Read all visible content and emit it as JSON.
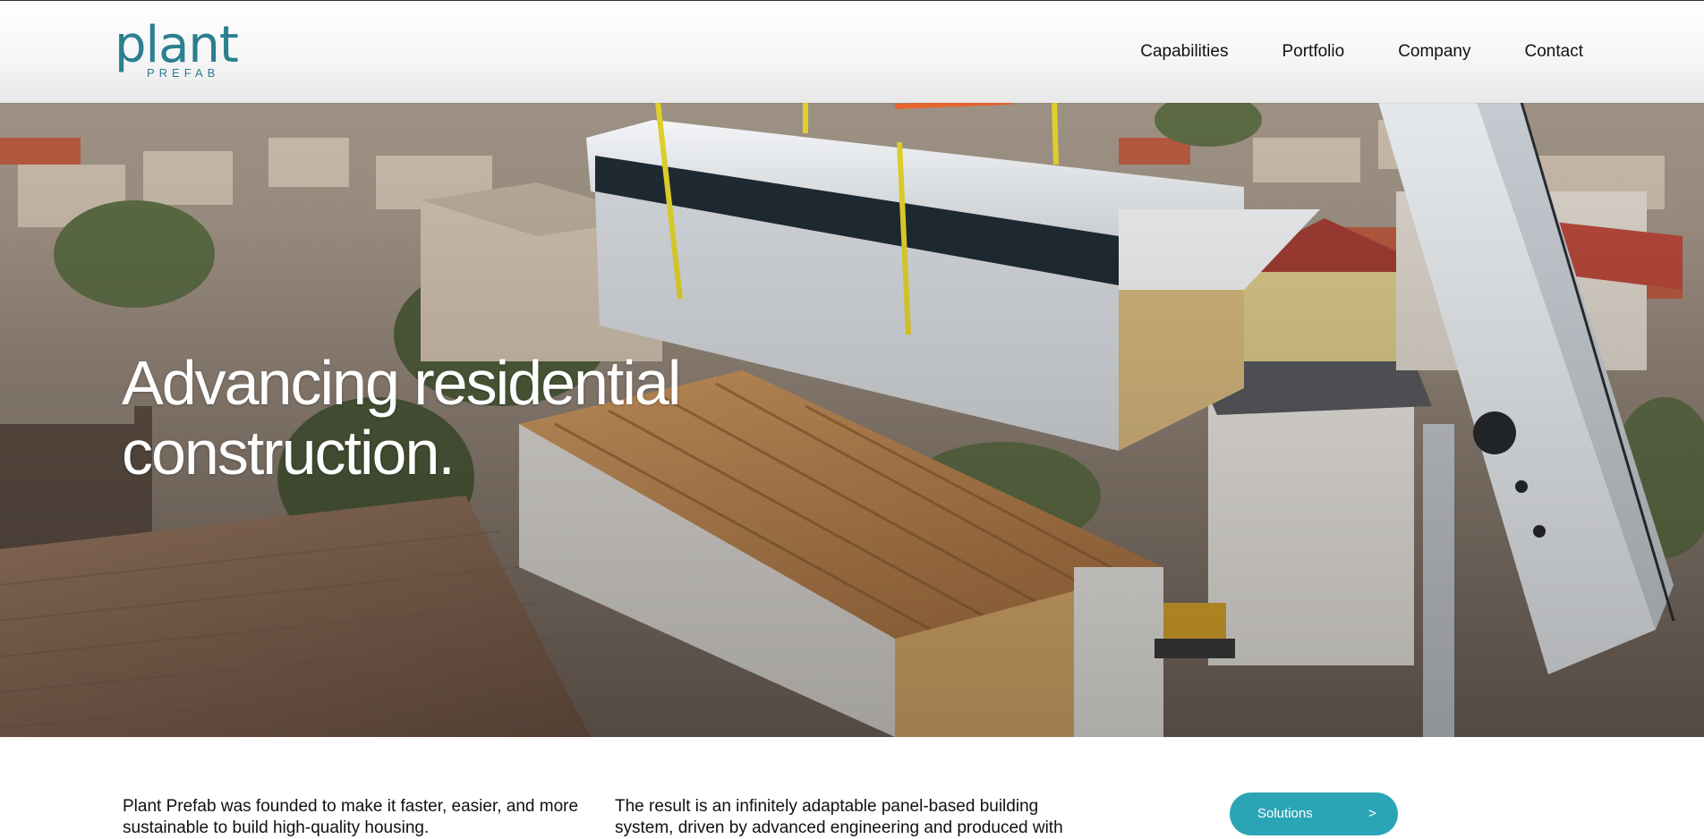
{
  "header": {
    "logo_word": "plant",
    "logo_sub": "PREFAB",
    "nav": [
      "Capabilities",
      "Portfolio",
      "Company",
      "Contact"
    ]
  },
  "hero": {
    "title_line1": "Advancing residential",
    "title_line2": "construction."
  },
  "intro": {
    "col1": "Plant Prefab was founded to make it faster, easier, and more sustainable to build high-quality housing.",
    "col2": "The result is an infinitely adaptable panel-based building system, driven by advanced engineering and produced with"
  },
  "cta": {
    "label": "Solutions",
    "chevron": ">"
  },
  "colors": {
    "brand": "#2b7f8f",
    "button": "#2ba5b6"
  }
}
